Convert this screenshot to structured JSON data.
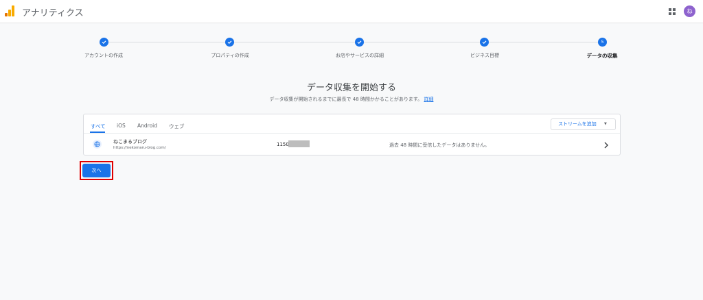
{
  "header": {
    "app_title": "アナリティクス",
    "avatar_initial": "ね",
    "logo_colors": [
      "#f9ab00",
      "#e37400"
    ]
  },
  "stepper": {
    "steps": [
      {
        "label": "アカウントの作成",
        "state": "done"
      },
      {
        "label": "プロパティの作成",
        "state": "done"
      },
      {
        "label": "お店やサービスの詳細",
        "state": "done"
      },
      {
        "label": "ビジネス目標",
        "state": "done"
      },
      {
        "label": "データの収集",
        "state": "current",
        "number": "5"
      }
    ]
  },
  "main": {
    "title": "データ収集を開始する",
    "subtitle": "データ収集が開始されるまでに最長で 48 時間かかることがあります。",
    "details_link": "詳細"
  },
  "streams": {
    "tabs": [
      "すべて",
      "iOS",
      "Android",
      "ウェブ"
    ],
    "active_tab": "すべて",
    "add_button": "ストリームを追加",
    "rows": [
      {
        "name": "ねこまるブログ",
        "url": "https://nekomaru-blog.com/",
        "id": "1150",
        "status": "過去 48 時間に受信したデータはありません。"
      }
    ]
  },
  "next_button": "次へ",
  "colors": {
    "accent": "#1a73e8",
    "highlight": "#e00000"
  }
}
